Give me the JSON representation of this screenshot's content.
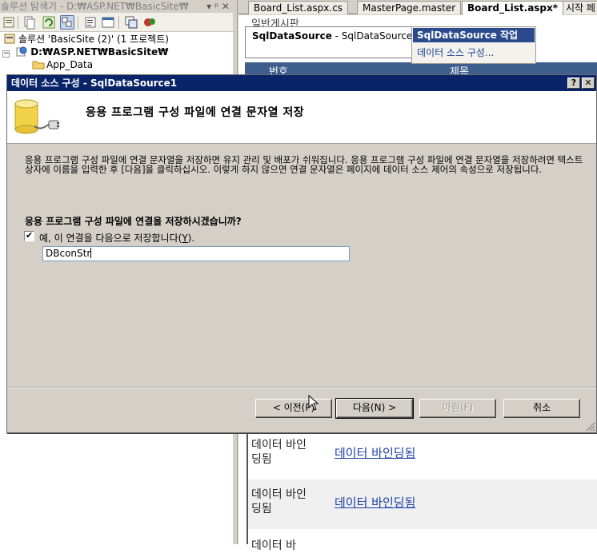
{
  "solution_explorer": {
    "title": "솔루션 탐색기 - D:₩ASP.NET₩BasicSite₩",
    "title_controls": "▾ ᵖ ✕",
    "solution_label": "솔루션 'BasicSite (2)' (1 프로젝트)",
    "site_label": "D:₩ASP.NET₩BasicSite₩",
    "app_data_label": "App_Data",
    "toolbar_icons": [
      "properties-icon",
      "show-all-files-icon",
      "refresh-icon",
      "nest-related-icon",
      "view-code-icon",
      "view-designer-icon",
      "copy-website-icon",
      "asp-config-icon"
    ]
  },
  "editor": {
    "tabs": [
      {
        "label": "Board_List.aspx.cs",
        "active": false
      },
      {
        "label": "MasterPage.master",
        "active": false
      },
      {
        "label": "Board_List.aspx*",
        "active": true
      },
      {
        "label": "시작 페",
        "active": false
      }
    ],
    "old_item_label": "일반게시판",
    "sqldatasource_label_bold": "SqlDataSource",
    "sqldatasource_label_rest": " - SqlDataSource1",
    "smart_tag": {
      "title": "SqlDataSource 작업",
      "link": "데이터 소스 구성..."
    },
    "grid_header": [
      "번호",
      "제목"
    ],
    "databound_rows": [
      {
        "cell1": "데이터 바인딩됨",
        "cell2": "데이터 바인딩됨"
      },
      {
        "cell1": "데이터 바인딩됨",
        "cell2": "데이터 바인딩됨"
      },
      {
        "cell1": "데이터 바",
        "cell2": ""
      }
    ]
  },
  "dialog": {
    "title": "데이터 소스 구성 - SqlDataSource1",
    "help_label": "?",
    "close_label": "✕",
    "heading": "응용 프로그램 구성 파일에 연결 문자열 저장",
    "description": "응용 프로그램 구성 파일에 연결 문자열을 저장하면 유지 관리 및 배포가 쉬워집니다. 응용 프로그램 구성 파일에 연결 문자열을 저장하려면 텍스트 상자에 이름을 입력한 후 [다음]을 클릭하십시오. 이렇게 하지 않으면 연결 문자열은 페이지에 데이터 소스 제어의 속성으로 저장됩니다.",
    "question": "응용 프로그램 구성 파일에 연결을 저장하시겠습니까?",
    "checkbox_checked": true,
    "checkbox_mark": "✔",
    "checkbox_label_prefix": "예, 이 연결을 다음으로 저장합니다(",
    "checkbox_label_key": "Y",
    "checkbox_label_suffix": ").",
    "connection_name": "DBconStr",
    "buttons": {
      "prev": "< 이전(P)",
      "next": "다음(N) >",
      "finish": "마침(F)",
      "cancel": "취소"
    }
  }
}
